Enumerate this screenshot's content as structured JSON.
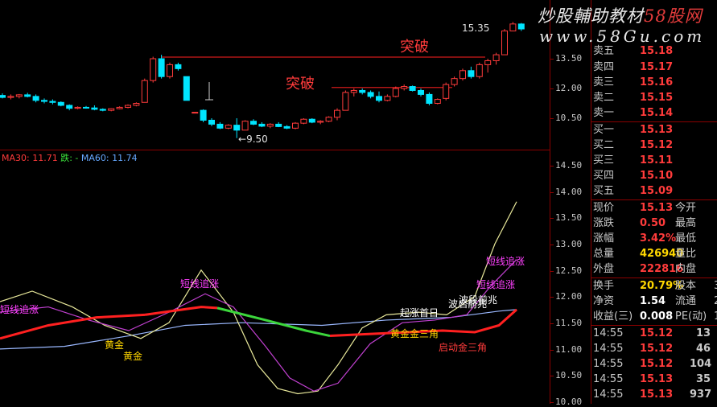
{
  "watermark": {
    "line1_a": "炒股輔助教材",
    "line1_b": "58股网",
    "line2": "www.58Gu.com"
  },
  "upper": {
    "annotations": {
      "breakout_top": "突破",
      "breakout_mid": "突破"
    },
    "high_label": "15.35",
    "low_label": "9.50",
    "axis_ticks": [
      "13.50",
      "12.00",
      "10.50"
    ],
    "candles": [
      {
        "o": 11.65,
        "h": 11.75,
        "l": 11.5,
        "c": 11.55
      },
      {
        "o": 11.55,
        "h": 11.7,
        "l": 11.45,
        "c": 11.6
      },
      {
        "o": 11.6,
        "h": 11.72,
        "l": 11.5,
        "c": 11.68
      },
      {
        "o": 11.68,
        "h": 11.78,
        "l": 11.55,
        "c": 11.6
      },
      {
        "o": 11.6,
        "h": 11.7,
        "l": 11.3,
        "c": 11.4
      },
      {
        "o": 11.4,
        "h": 11.5,
        "l": 11.25,
        "c": 11.35
      },
      {
        "o": 11.35,
        "h": 11.45,
        "l": 11.2,
        "c": 11.3
      },
      {
        "o": 11.3,
        "h": 11.35,
        "l": 11.1,
        "c": 11.15
      },
      {
        "o": 11.15,
        "h": 11.2,
        "l": 10.9,
        "c": 11.0
      },
      {
        "o": 11.0,
        "h": 11.1,
        "l": 10.95,
        "c": 11.05
      },
      {
        "o": 11.05,
        "h": 11.12,
        "l": 10.98,
        "c": 11.02
      },
      {
        "o": 11.02,
        "h": 11.15,
        "l": 10.9,
        "c": 10.95
      },
      {
        "o": 10.95,
        "h": 11.0,
        "l": 10.85,
        "c": 10.9
      },
      {
        "o": 10.9,
        "h": 11.0,
        "l": 10.85,
        "c": 10.98
      },
      {
        "o": 10.98,
        "h": 11.1,
        "l": 10.95,
        "c": 11.05
      },
      {
        "o": 11.05,
        "h": 11.2,
        "l": 11.0,
        "c": 11.15
      },
      {
        "o": 11.15,
        "h": 11.3,
        "l": 11.1,
        "c": 11.25
      },
      {
        "o": 11.3,
        "h": 12.5,
        "l": 11.3,
        "c": 12.4
      },
      {
        "o": 12.4,
        "h": 13.6,
        "l": 12.3,
        "c": 13.5
      },
      {
        "o": 13.5,
        "h": 13.7,
        "l": 12.5,
        "c": 12.6
      },
      {
        "o": 12.6,
        "h": 13.3,
        "l": 12.5,
        "c": 13.2
      },
      {
        "o": 13.2,
        "h": 13.3,
        "l": 12.9,
        "c": 13.0
      },
      {
        "o": 12.6,
        "h": 12.6,
        "l": 11.4,
        "c": 11.4
      },
      {
        "o": 10.8,
        "h": 10.8,
        "l": 10.8,
        "c": 10.8
      },
      {
        "o": 10.9,
        "h": 10.95,
        "l": 10.3,
        "c": 10.4
      },
      {
        "o": 10.4,
        "h": 10.5,
        "l": 10.1,
        "c": 10.2
      },
      {
        "o": 10.2,
        "h": 10.3,
        "l": 9.95,
        "c": 10.0
      },
      {
        "o": 10.0,
        "h": 10.2,
        "l": 9.95,
        "c": 10.15
      },
      {
        "o": 10.15,
        "h": 10.5,
        "l": 9.5,
        "c": 9.9
      },
      {
        "o": 9.9,
        "h": 10.4,
        "l": 9.9,
        "c": 10.35
      },
      {
        "o": 10.35,
        "h": 10.45,
        "l": 10.15,
        "c": 10.2
      },
      {
        "o": 10.2,
        "h": 10.3,
        "l": 10.05,
        "c": 10.1
      },
      {
        "o": 10.1,
        "h": 10.25,
        "l": 10.0,
        "c": 10.2
      },
      {
        "o": 10.2,
        "h": 10.3,
        "l": 10.05,
        "c": 10.08
      },
      {
        "o": 10.08,
        "h": 10.15,
        "l": 9.95,
        "c": 10.0
      },
      {
        "o": 10.0,
        "h": 10.3,
        "l": 9.95,
        "c": 10.25
      },
      {
        "o": 10.25,
        "h": 10.5,
        "l": 10.2,
        "c": 10.45
      },
      {
        "o": 10.45,
        "h": 10.5,
        "l": 10.25,
        "c": 10.3
      },
      {
        "o": 10.3,
        "h": 10.4,
        "l": 10.2,
        "c": 10.35
      },
      {
        "o": 10.35,
        "h": 10.6,
        "l": 10.3,
        "c": 10.55
      },
      {
        "o": 10.55,
        "h": 11.0,
        "l": 10.4,
        "c": 10.9
      },
      {
        "o": 10.9,
        "h": 11.9,
        "l": 10.9,
        "c": 11.8
      },
      {
        "o": 11.8,
        "h": 12.0,
        "l": 11.6,
        "c": 11.9
      },
      {
        "o": 11.9,
        "h": 12.0,
        "l": 11.7,
        "c": 11.8
      },
      {
        "o": 11.8,
        "h": 11.9,
        "l": 11.5,
        "c": 11.6
      },
      {
        "o": 11.6,
        "h": 11.85,
        "l": 11.3,
        "c": 11.4
      },
      {
        "o": 11.4,
        "h": 11.7,
        "l": 11.35,
        "c": 11.6
      },
      {
        "o": 11.6,
        "h": 12.1,
        "l": 11.55,
        "c": 12.0
      },
      {
        "o": 12.0,
        "h": 12.2,
        "l": 11.9,
        "c": 12.1
      },
      {
        "o": 12.1,
        "h": 12.15,
        "l": 11.85,
        "c": 11.9
      },
      {
        "o": 11.9,
        "h": 12.0,
        "l": 11.6,
        "c": 11.7
      },
      {
        "o": 11.7,
        "h": 11.8,
        "l": 11.15,
        "c": 11.25
      },
      {
        "o": 11.25,
        "h": 11.5,
        "l": 11.2,
        "c": 11.45
      },
      {
        "o": 11.5,
        "h": 12.3,
        "l": 11.4,
        "c": 12.2
      },
      {
        "o": 12.2,
        "h": 12.6,
        "l": 12.1,
        "c": 12.5
      },
      {
        "o": 12.5,
        "h": 13.0,
        "l": 12.4,
        "c": 12.9
      },
      {
        "o": 12.9,
        "h": 13.1,
        "l": 12.5,
        "c": 12.6
      },
      {
        "o": 12.6,
        "h": 13.3,
        "l": 12.5,
        "c": 13.2
      },
      {
        "o": 13.2,
        "h": 13.5,
        "l": 12.8,
        "c": 13.4
      },
      {
        "o": 13.4,
        "h": 13.8,
        "l": 13.2,
        "c": 13.7
      },
      {
        "o": 13.7,
        "h": 15.0,
        "l": 13.7,
        "c": 14.9
      },
      {
        "o": 14.9,
        "h": 15.35,
        "l": 14.9,
        "c": 15.25
      },
      {
        "o": 15.25,
        "h": 15.3,
        "l": 14.9,
        "c": 15.0
      }
    ]
  },
  "lower": {
    "indicator_title": {
      "ma30": "MA30: 11.71",
      "dash": "跌: -",
      "ma60": "MA60: 11.74"
    },
    "axis_ticks": [
      "14.50",
      "14.00",
      "13.50",
      "13.00",
      "12.50",
      "12.00",
      "11.50",
      "11.00",
      "10.50",
      "10.00"
    ],
    "labels": {
      "short_rise_left": "短线追涨",
      "short_rise_mid": "短线追涨",
      "short_rise_right1": "短线追涨",
      "short_rise_right2": "短线追涨",
      "golden_a": "黄金",
      "golden_b": "黄金",
      "rise_first_day": "起涨首日",
      "band_start": "波段前兆",
      "wave_start": "波启前兆",
      "golden_triangle": "黄金金三角",
      "start_triangle": "启动金三角"
    }
  },
  "quote": {
    "asks": [
      {
        "label": "卖五",
        "price": "15.18"
      },
      {
        "label": "卖四",
        "price": "15.17"
      },
      {
        "label": "卖三",
        "price": "15.16"
      },
      {
        "label": "卖二",
        "price": "15.15"
      },
      {
        "label": "卖一",
        "price": "15.14"
      }
    ],
    "bids": [
      {
        "label": "买一",
        "price": "15.13"
      },
      {
        "label": "买二",
        "price": "15.12"
      },
      {
        "label": "买三",
        "price": "15.11"
      },
      {
        "label": "买四",
        "price": "15.10"
      },
      {
        "label": "买五",
        "price": "15.09"
      }
    ],
    "stats": [
      {
        "label": "现价",
        "value": "15.13",
        "label2": "今开"
      },
      {
        "label": "涨跌",
        "value": "0.50",
        "label2": "最高"
      },
      {
        "label": "涨幅",
        "value": "3.42%",
        "label2": "最低"
      },
      {
        "label": "总量",
        "value": "426940",
        "label2": "量比"
      },
      {
        "label": "外盘",
        "value": "222816",
        "label2": "内盘"
      }
    ],
    "stats2": [
      {
        "label": "换手",
        "value": "20.79%",
        "label2": "股本",
        "tail": "3"
      },
      {
        "label": "净资",
        "value": "1.54",
        "label2": "流通",
        "tail": "2"
      },
      {
        "label": "收益(三)",
        "value": "0.008",
        "label2": "PE(动)",
        "tail": "1"
      }
    ],
    "ticks": [
      {
        "time": "14:55",
        "price": "15.12",
        "vol": "13"
      },
      {
        "time": "14:55",
        "price": "15.12",
        "vol": "46"
      },
      {
        "time": "14:55",
        "price": "15.12",
        "vol": "104"
      },
      {
        "time": "14:55",
        "price": "15.13",
        "vol": "35"
      },
      {
        "time": "14:55",
        "price": "15.13",
        "vol": "937"
      }
    ],
    "colors": {
      "up": "#ff3b3b",
      "down": "#00e5ff",
      "accent": "#ffd700"
    }
  }
}
